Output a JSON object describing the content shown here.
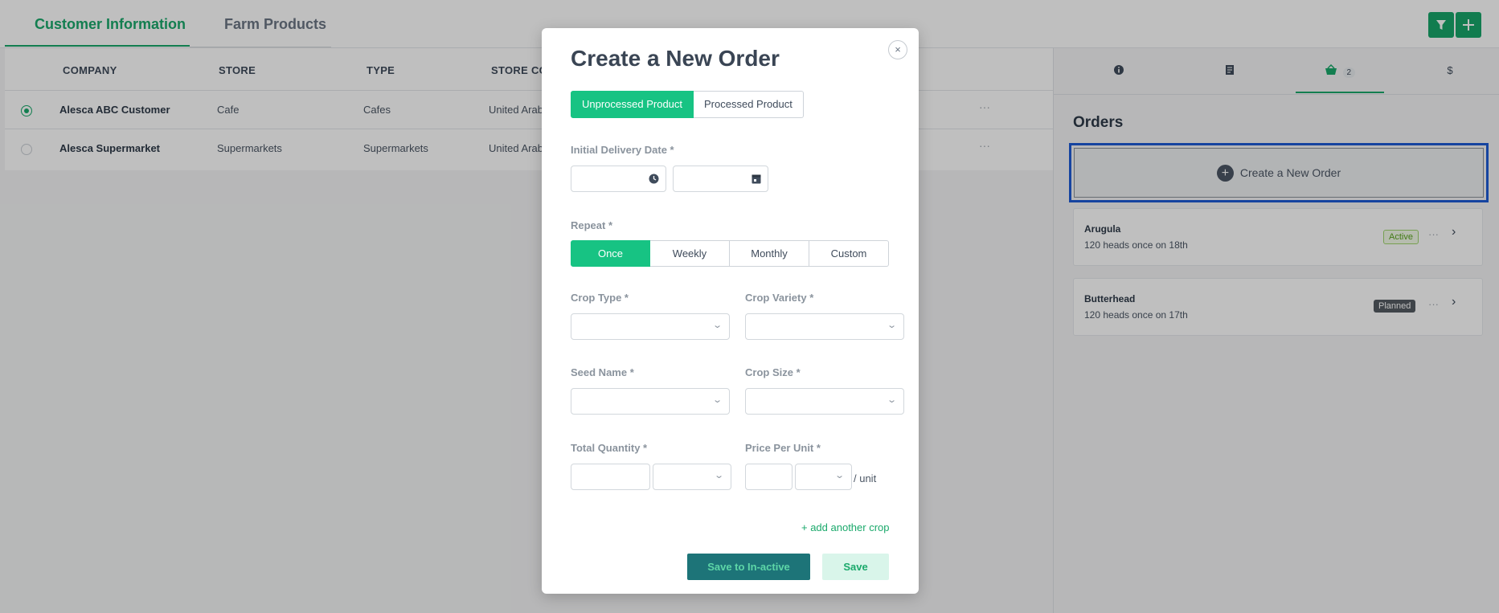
{
  "tabs": {
    "customer": "Customer Information",
    "farm": "Farm Products"
  },
  "table": {
    "headers": [
      "COMPANY",
      "STORE",
      "TYPE",
      "STORE CO"
    ],
    "rows": [
      {
        "company": "Alesca ABC Customer",
        "store": "Cafe",
        "type": "Cafes",
        "country": "United Arab",
        "selected": true
      },
      {
        "company": "Alesca Supermarket",
        "store": "Supermarkets",
        "type": "Supermarkets",
        "country": "United Arab",
        "selected": false
      }
    ],
    "row_menu": "···"
  },
  "panel": {
    "basket_count": "2",
    "dollar": "$",
    "orders_title": "Orders",
    "create_order": "Create a New Order",
    "plus": "+",
    "orders": [
      {
        "name": "Arugula",
        "desc": "120 heads once on 18th",
        "status": "Active"
      },
      {
        "name": "Butterhead",
        "desc": "120 heads once on 17th",
        "status": "Planned"
      }
    ],
    "menu": "···",
    "chevron": "›"
  },
  "modal": {
    "title": "Create a New Order",
    "close": "×",
    "product_types": [
      "Unprocessed Product",
      "Processed Product"
    ],
    "delivery_label": "Initial Delivery Date *",
    "repeat_label": "Repeat *",
    "repeat_options": [
      "Once",
      "Weekly",
      "Monthly",
      "Custom"
    ],
    "crop_type_label": "Crop Type *",
    "crop_variety_label": "Crop Variety *",
    "seed_name_label": "Seed Name *",
    "crop_size_label": "Crop Size *",
    "total_quantity_label": "Total Quantity *",
    "price_label": "Price Per Unit *",
    "unit_suffix": "/ unit",
    "add_crop": "+ add another crop",
    "save_inactive": "Save to In-active",
    "save": "Save"
  },
  "colors": {
    "accent": "#17c383",
    "brand": "#1aa96b",
    "focus": "#1e5bd6"
  }
}
